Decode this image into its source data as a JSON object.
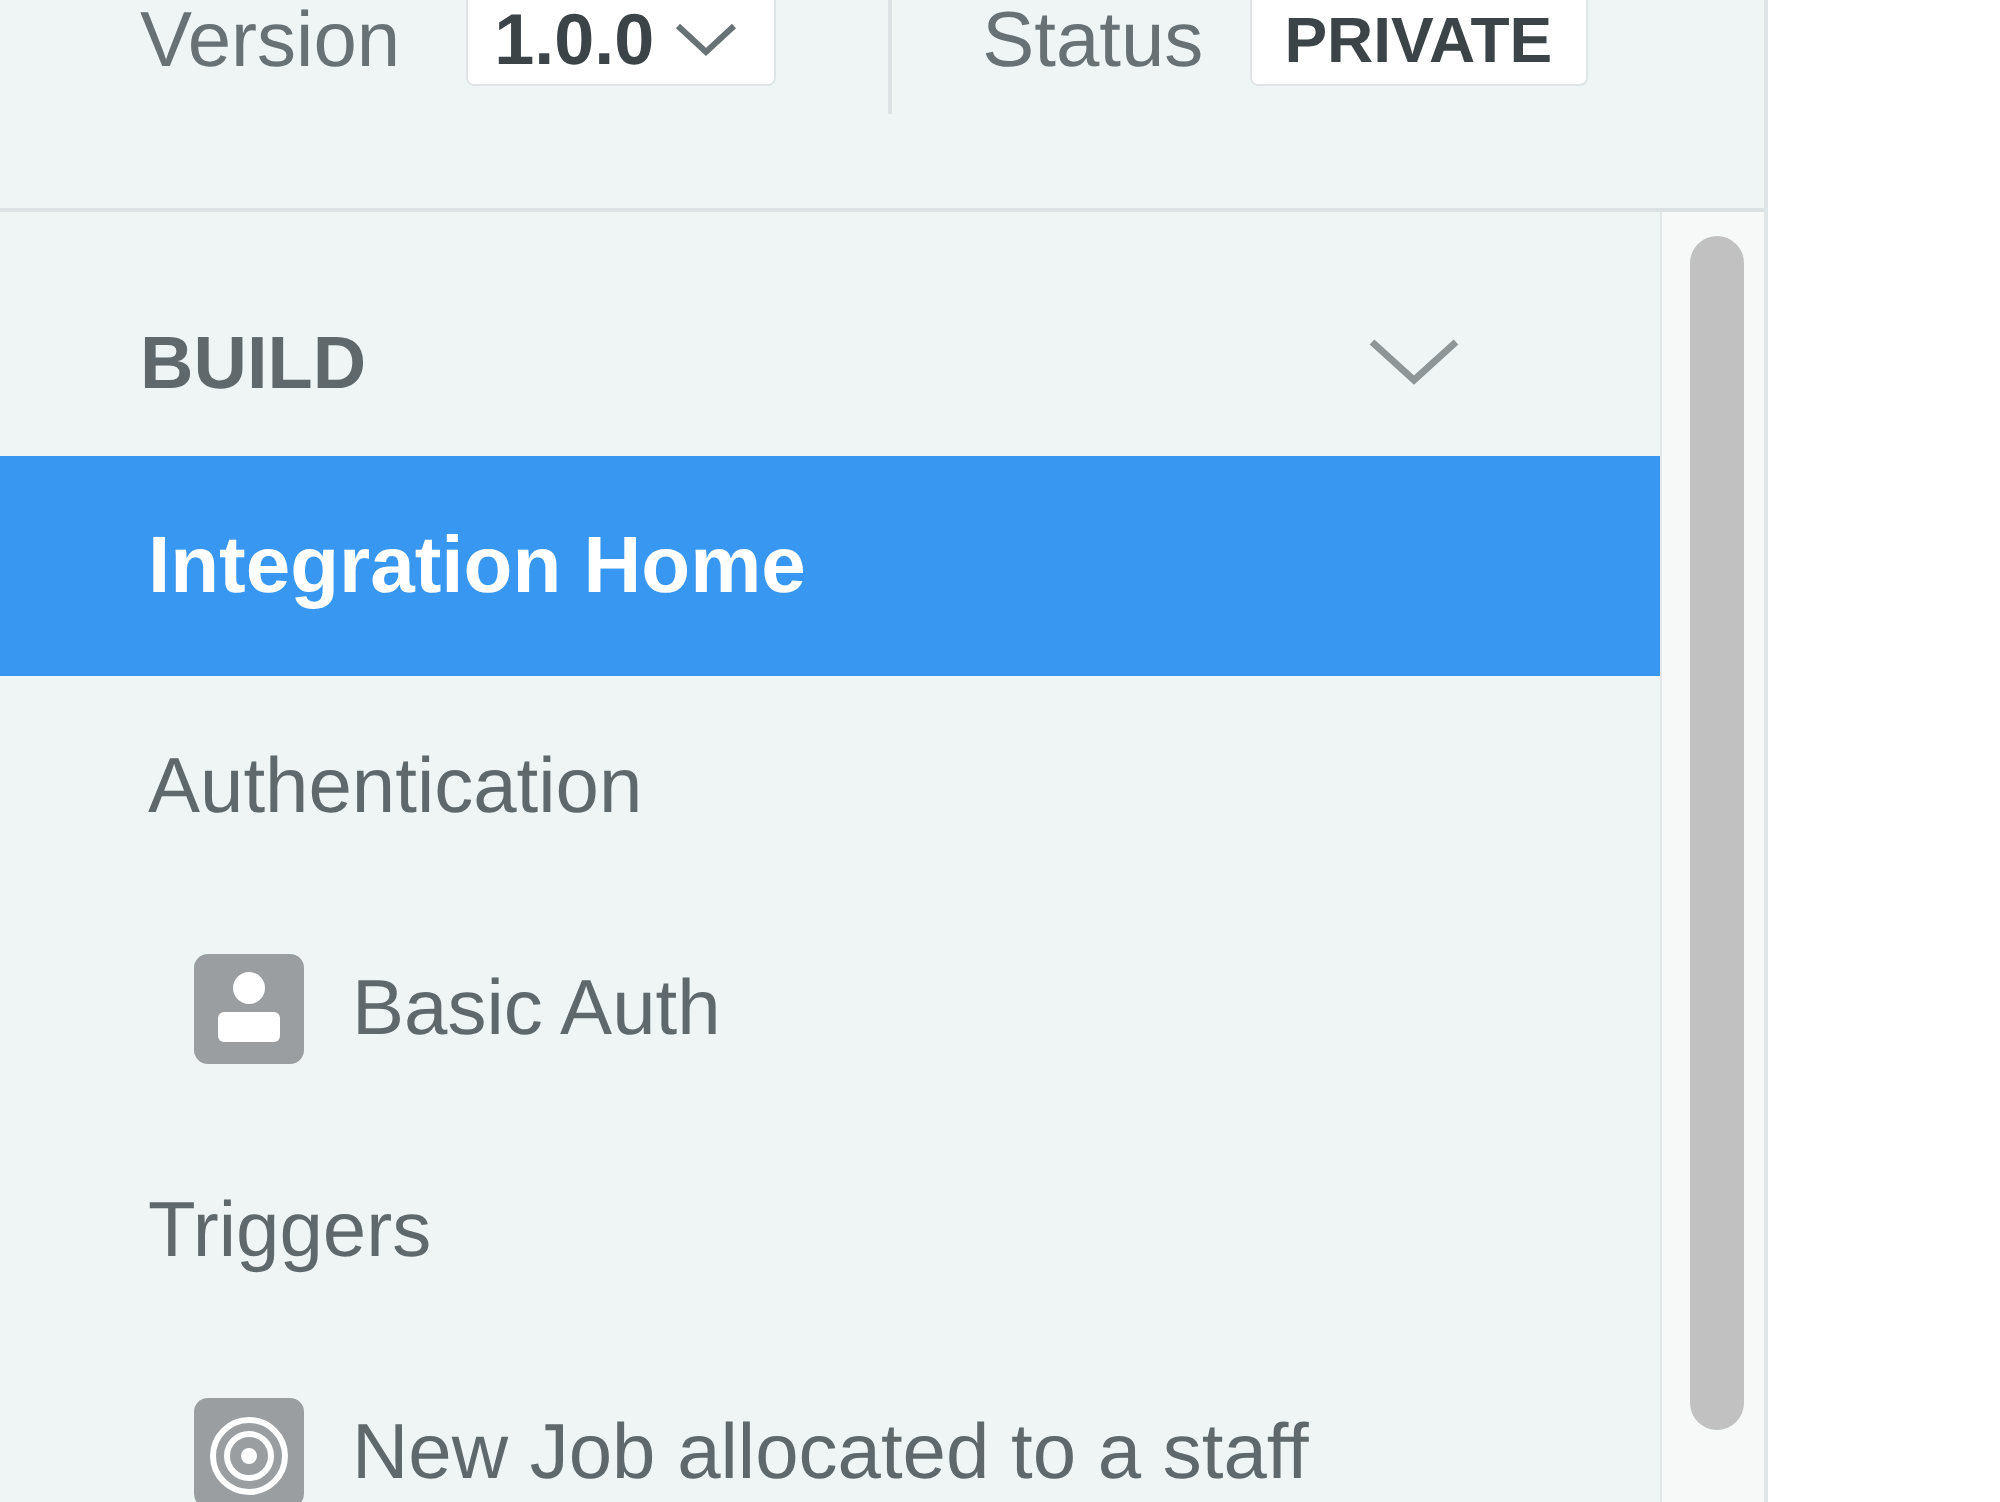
{
  "header": {
    "version": {
      "label": "Version",
      "value": "1.0.0"
    },
    "status": {
      "label": "Status",
      "value": "PRIVATE"
    }
  },
  "sidebar": {
    "section": {
      "title": "BUILD",
      "expanded": true
    },
    "items": [
      {
        "kind": "page",
        "label": "Integration Home",
        "selected": true
      },
      {
        "kind": "group",
        "label": "Authentication",
        "selected": false
      },
      {
        "kind": "auth",
        "label": "Basic Auth",
        "selected": false
      },
      {
        "kind": "group",
        "label": "Triggers",
        "selected": false
      },
      {
        "kind": "trigger",
        "label": "New Job allocated to a staff",
        "selected": false
      }
    ]
  }
}
